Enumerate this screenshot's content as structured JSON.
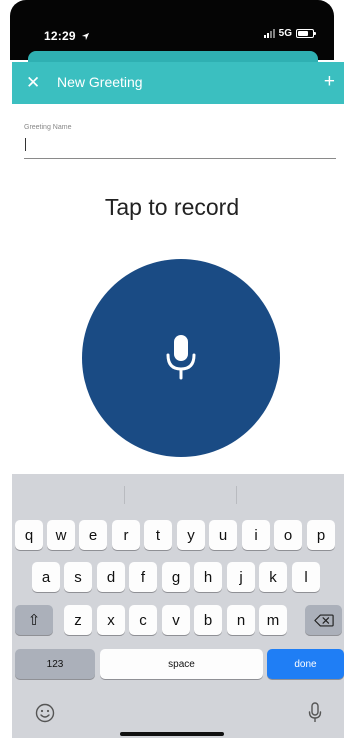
{
  "status": {
    "time": "12:29",
    "network": "5G"
  },
  "header": {
    "close_glyph": "✕",
    "title": "New Greeting",
    "add_glyph": "+",
    "color": "#3bbfc0"
  },
  "form": {
    "greeting_name_label": "Greeting Name",
    "greeting_name_value": ""
  },
  "record": {
    "prompt": "Tap to record",
    "button_color": "#1a4b84",
    "icon": "microphone-icon"
  },
  "keyboard": {
    "row1": [
      "q",
      "w",
      "e",
      "r",
      "t",
      "y",
      "u",
      "i",
      "o",
      "p"
    ],
    "row2": [
      "a",
      "s",
      "d",
      "f",
      "g",
      "h",
      "j",
      "k",
      "l"
    ],
    "row3": [
      "z",
      "x",
      "c",
      "v",
      "b",
      "n",
      "m"
    ],
    "shift_glyph": "⇧",
    "numbers_label": "123",
    "space_label": "space",
    "done_label": "done",
    "emoji_icon": "emoji-icon",
    "dictation_icon": "microphone-icon"
  }
}
